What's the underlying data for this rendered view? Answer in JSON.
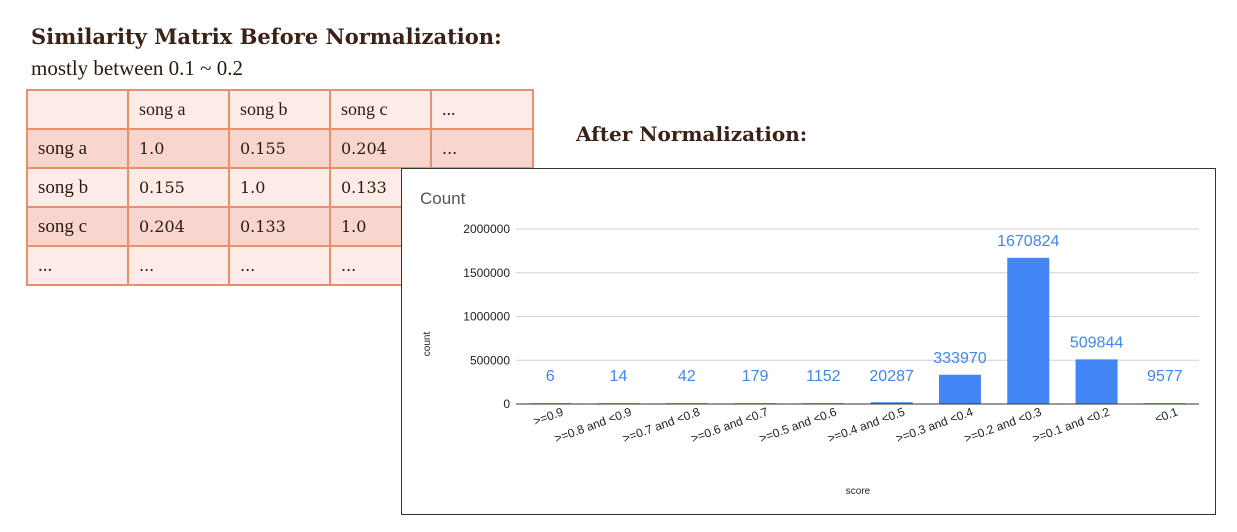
{
  "header": {
    "title": "Similarity Matrix Before Normalization:",
    "subtitle": "mostly between 0.1 ~ 0.2",
    "after_title": "After Normalization:"
  },
  "matrix": {
    "header": [
      "",
      "song a",
      "song b",
      "song c",
      "..."
    ],
    "rows": [
      [
        "song a",
        "1.0",
        "0.155",
        "0.204",
        "..."
      ],
      [
        "song b",
        "0.155",
        "1.0",
        "0.133",
        ""
      ],
      [
        "song c",
        "0.204",
        "0.133",
        "1.0",
        ""
      ],
      [
        "...",
        "...",
        "...",
        "...",
        ""
      ]
    ]
  },
  "chart_data": {
    "type": "bar",
    "title": "Count",
    "xlabel": "score",
    "ylabel": "count",
    "categories": [
      ">=0.9",
      ">=0.8 and <0.9",
      ">=0.7 and <0.8",
      ">=0.6 and <0.7",
      ">=0.5 and <0.6",
      ">=0.4 and <0.5",
      ">=0.3 and <0.4",
      ">=0.2 and <0.3",
      ">=0.1 and <0.2",
      "<0.1"
    ],
    "values": [
      6,
      14,
      42,
      179,
      1152,
      20287,
      333970,
      1670824,
      509844,
      9577
    ],
    "ylim": [
      0,
      2000000
    ],
    "yticks": [
      0,
      500000,
      1000000,
      1500000,
      2000000
    ],
    "grid": true,
    "legend": "none",
    "bar_color": "#4285f4",
    "label_color": "#4285f4"
  }
}
